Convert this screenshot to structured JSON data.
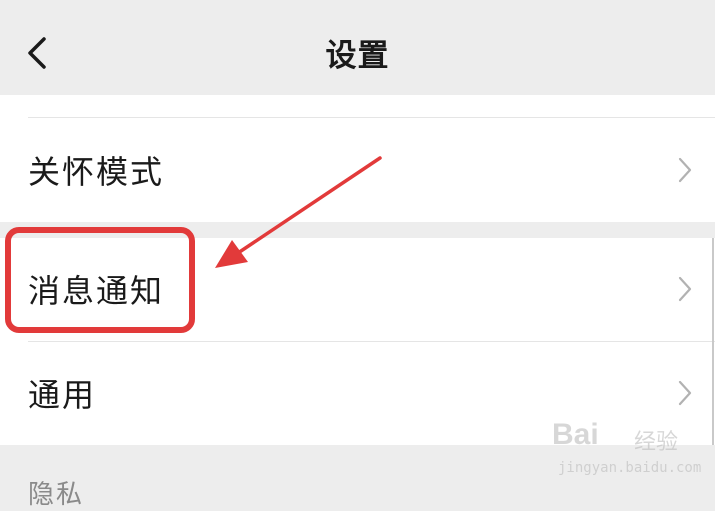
{
  "header": {
    "title": "设置",
    "back_icon": "chevron-left-icon"
  },
  "settings": {
    "items": [
      {
        "label": "关怀模式",
        "icon": "chevron-right-icon"
      },
      {
        "label": "消息通知",
        "icon": "chevron-right-icon"
      },
      {
        "label": "通用",
        "icon": "chevron-right-icon"
      }
    ],
    "section_privacy": "隐私"
  },
  "annotation": {
    "highlight_color": "#e23a3a",
    "arrow_color": "#e23a3a"
  },
  "watermark": {
    "brand": "Bai",
    "product": "经验",
    "url": "jingyan.baidu.com"
  }
}
